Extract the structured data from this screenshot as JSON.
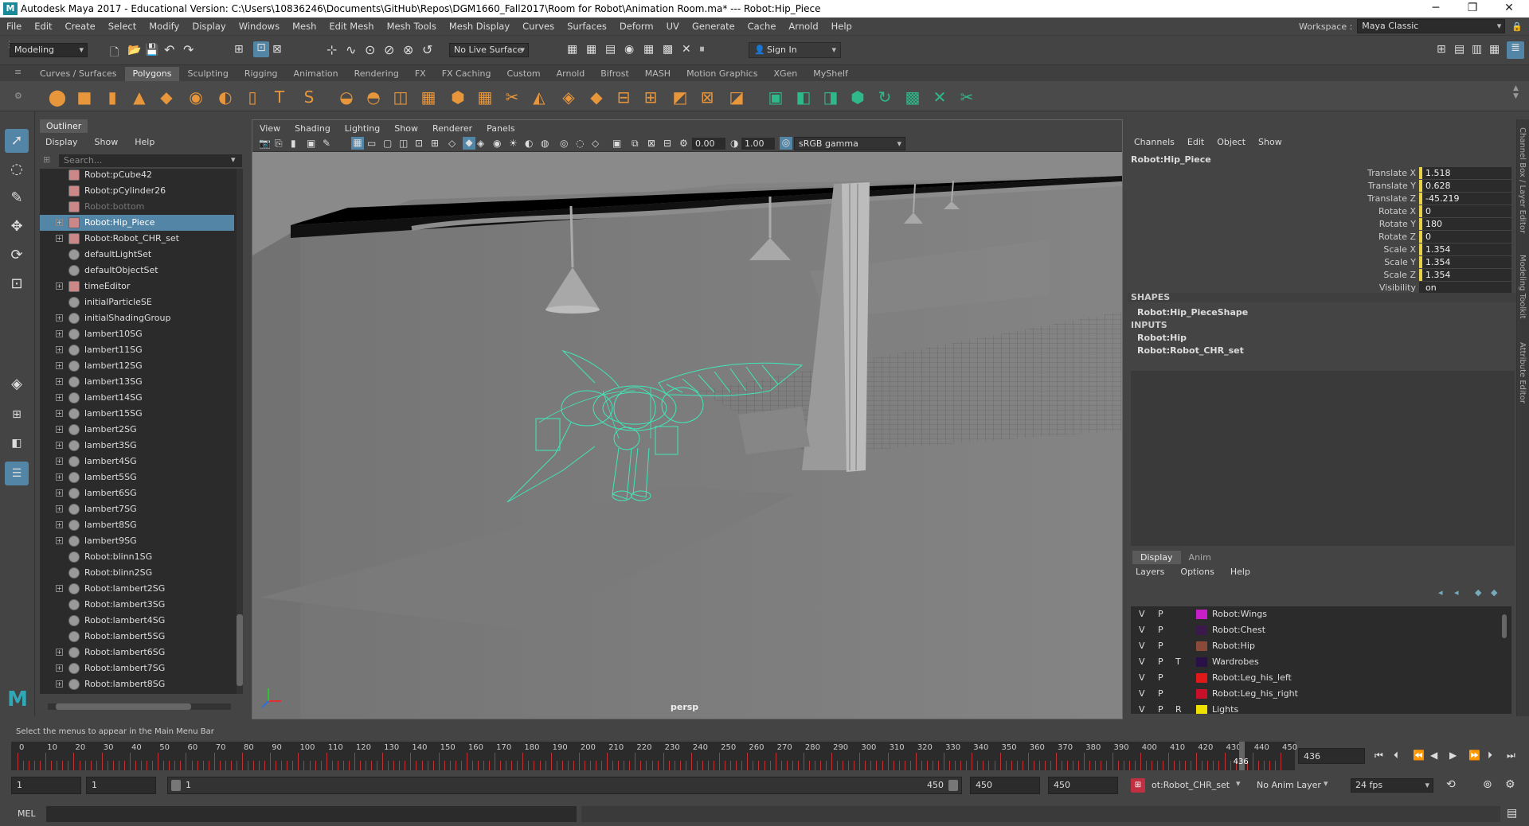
{
  "app": {
    "title": "Autodesk Maya 2017 - Educational Version: C:\\Users\\10836246\\Documents\\GitHub\\Repos\\DGM1660_Fall2017\\Room for Robot\\Animation Room.ma*   ---   Robot:Hip_Piece",
    "logo_letter": "M",
    "minimize": "─",
    "maximize": "❐",
    "close": "✕"
  },
  "menubar": [
    "File",
    "Edit",
    "Create",
    "Select",
    "Modify",
    "Display",
    "Windows",
    "Mesh",
    "Edit Mesh",
    "Mesh Tools",
    "Mesh Display",
    "Curves",
    "Surfaces",
    "Deform",
    "UV",
    "Generate",
    "Cache",
    "Arnold",
    "Help"
  ],
  "workspace": {
    "label": "Workspace :",
    "value": "Maya Classic"
  },
  "statusline": {
    "mode": "Modeling",
    "live_surface": "No Live Surface",
    "sign_in": "Sign In"
  },
  "shelf_tabs": [
    "Curves / Surfaces",
    "Polygons",
    "Sculpting",
    "Rigging",
    "Animation",
    "Rendering",
    "FX",
    "FX Caching",
    "Custom",
    "Arnold",
    "Bifrost",
    "MASH",
    "Motion Graphics",
    "XGen",
    "MyShelf"
  ],
  "shelf_active": "Polygons",
  "outliner": {
    "title": "Outliner",
    "menu": [
      "Display",
      "Show",
      "Help"
    ],
    "search_placeholder": "Search...",
    "items": [
      {
        "label": "Robot:pCube42",
        "exp": false,
        "type": "mesh",
        "state": ""
      },
      {
        "label": "Robot:pCylinder26",
        "exp": false,
        "type": "mesh",
        "state": ""
      },
      {
        "label": "Robot:bottom",
        "exp": false,
        "type": "mesh",
        "state": "dim"
      },
      {
        "label": "Robot:Hip_Piece",
        "exp": true,
        "type": "mesh",
        "state": "sel"
      },
      {
        "label": "Robot:Robot_CHR_set",
        "exp": true,
        "type": "mesh",
        "state": ""
      },
      {
        "label": "defaultLightSet",
        "exp": false,
        "type": "set",
        "state": ""
      },
      {
        "label": "defaultObjectSet",
        "exp": false,
        "type": "set",
        "state": ""
      },
      {
        "label": "timeEditor",
        "exp": true,
        "type": "mesh",
        "state": ""
      },
      {
        "label": "initialParticleSE",
        "exp": false,
        "type": "set",
        "state": ""
      },
      {
        "label": "initialShadingGroup",
        "exp": true,
        "type": "set",
        "state": ""
      },
      {
        "label": "lambert10SG",
        "exp": true,
        "type": "set",
        "state": ""
      },
      {
        "label": "lambert11SG",
        "exp": true,
        "type": "set",
        "state": ""
      },
      {
        "label": "lambert12SG",
        "exp": true,
        "type": "set",
        "state": ""
      },
      {
        "label": "lambert13SG",
        "exp": true,
        "type": "set",
        "state": ""
      },
      {
        "label": "lambert14SG",
        "exp": true,
        "type": "set",
        "state": ""
      },
      {
        "label": "lambert15SG",
        "exp": true,
        "type": "set",
        "state": ""
      },
      {
        "label": "lambert2SG",
        "exp": true,
        "type": "set",
        "state": ""
      },
      {
        "label": "lambert3SG",
        "exp": true,
        "type": "set",
        "state": ""
      },
      {
        "label": "lambert4SG",
        "exp": true,
        "type": "set",
        "state": ""
      },
      {
        "label": "lambert5SG",
        "exp": true,
        "type": "set",
        "state": ""
      },
      {
        "label": "lambert6SG",
        "exp": true,
        "type": "set",
        "state": ""
      },
      {
        "label": "lambert7SG",
        "exp": true,
        "type": "set",
        "state": ""
      },
      {
        "label": "lambert8SG",
        "exp": true,
        "type": "set",
        "state": ""
      },
      {
        "label": "lambert9SG",
        "exp": true,
        "type": "set",
        "state": ""
      },
      {
        "label": "Robot:blinn1SG",
        "exp": false,
        "type": "set",
        "state": ""
      },
      {
        "label": "Robot:blinn2SG",
        "exp": false,
        "type": "set",
        "state": ""
      },
      {
        "label": "Robot:lambert2SG",
        "exp": true,
        "type": "set",
        "state": ""
      },
      {
        "label": "Robot:lambert3SG",
        "exp": false,
        "type": "set",
        "state": ""
      },
      {
        "label": "Robot:lambert4SG",
        "exp": false,
        "type": "set",
        "state": ""
      },
      {
        "label": "Robot:lambert5SG",
        "exp": false,
        "type": "set",
        "state": ""
      },
      {
        "label": "Robot:lambert6SG",
        "exp": true,
        "type": "set",
        "state": ""
      },
      {
        "label": "Robot:lambert7SG",
        "exp": true,
        "type": "set",
        "state": ""
      },
      {
        "label": "Robot:lambert8SG",
        "exp": true,
        "type": "set",
        "state": ""
      }
    ]
  },
  "viewport": {
    "menu": [
      "View",
      "Shading",
      "Lighting",
      "Show",
      "Renderer",
      "Panels"
    ],
    "exposure": "0.00",
    "gamma": "1.00",
    "colorspace": "sRGB gamma",
    "camera": "persp"
  },
  "channel_box": {
    "menu": [
      "Channels",
      "Edit",
      "Object",
      "Show"
    ],
    "object": "Robot:Hip_Piece",
    "attrs": [
      {
        "name": "Translate X",
        "value": "1.518",
        "keyed": true
      },
      {
        "name": "Translate Y",
        "value": "0.628",
        "keyed": true
      },
      {
        "name": "Translate Z",
        "value": "-45.219",
        "keyed": true
      },
      {
        "name": "Rotate X",
        "value": "0",
        "keyed": true
      },
      {
        "name": "Rotate Y",
        "value": "180",
        "keyed": true
      },
      {
        "name": "Rotate Z",
        "value": "0",
        "keyed": true
      },
      {
        "name": "Scale X",
        "value": "1.354",
        "keyed": true
      },
      {
        "name": "Scale Y",
        "value": "1.354",
        "keyed": true
      },
      {
        "name": "Scale Z",
        "value": "1.354",
        "keyed": true
      },
      {
        "name": "Visibility",
        "value": "on",
        "keyed": false
      }
    ],
    "shapes_label": "SHAPES",
    "shape": "Robot:Hip_PieceShape",
    "inputs_label": "INPUTS",
    "inputs": [
      "Robot:Hip",
      "Robot:Robot_CHR_set"
    ]
  },
  "side_tabs": [
    "Channel Box / Layer Editor",
    "Modeling Toolkit",
    "Attribute Editor"
  ],
  "layer_editor": {
    "tabs": [
      "Display",
      "Anim"
    ],
    "menu": [
      "Layers",
      "Options",
      "Help"
    ],
    "layers": [
      {
        "v": "V",
        "p": "P",
        "t": "",
        "color": "#c81ec8",
        "name": "Robot:Wings"
      },
      {
        "v": "V",
        "p": "P",
        "t": "",
        "color": "#3a1a4a",
        "name": "Robot:Chest"
      },
      {
        "v": "V",
        "p": "P",
        "t": "",
        "color": "#8a4a3a",
        "name": "Robot:Hip"
      },
      {
        "v": "V",
        "p": "P",
        "t": "T",
        "color": "#2a1048",
        "name": "Wardrobes"
      },
      {
        "v": "V",
        "p": "P",
        "t": "",
        "color": "#e01818",
        "name": "Robot:Leg_his_left"
      },
      {
        "v": "V",
        "p": "P",
        "t": "",
        "color": "#c8102a",
        "name": "Robot:Leg_his_right"
      },
      {
        "v": "V",
        "p": "P",
        "t": "R",
        "color": "#f0e000",
        "name": "Lights"
      }
    ]
  },
  "help_line": "Select the menus to appear in the Main Menu Bar",
  "timeline": {
    "ticks": [
      0,
      10,
      20,
      30,
      40,
      50,
      60,
      70,
      80,
      90,
      100,
      110,
      120,
      130,
      140,
      150,
      160,
      170,
      180,
      190,
      200,
      210,
      220,
      230,
      240,
      250,
      260,
      270,
      280,
      290,
      300,
      310,
      320,
      330,
      340,
      350,
      360,
      370,
      380,
      390,
      400,
      410,
      420,
      430,
      440,
      450
    ],
    "current": "436",
    "current_field": "436",
    "end": 450
  },
  "range": {
    "start": "1",
    "start2": "1",
    "slider_start": "1",
    "slider_end": "450",
    "end": "450",
    "end2": "450",
    "character_set": "ot:Robot_CHR_set",
    "anim_layer": "No Anim Layer",
    "fps": "24 fps"
  },
  "cmd": {
    "label": "MEL"
  }
}
